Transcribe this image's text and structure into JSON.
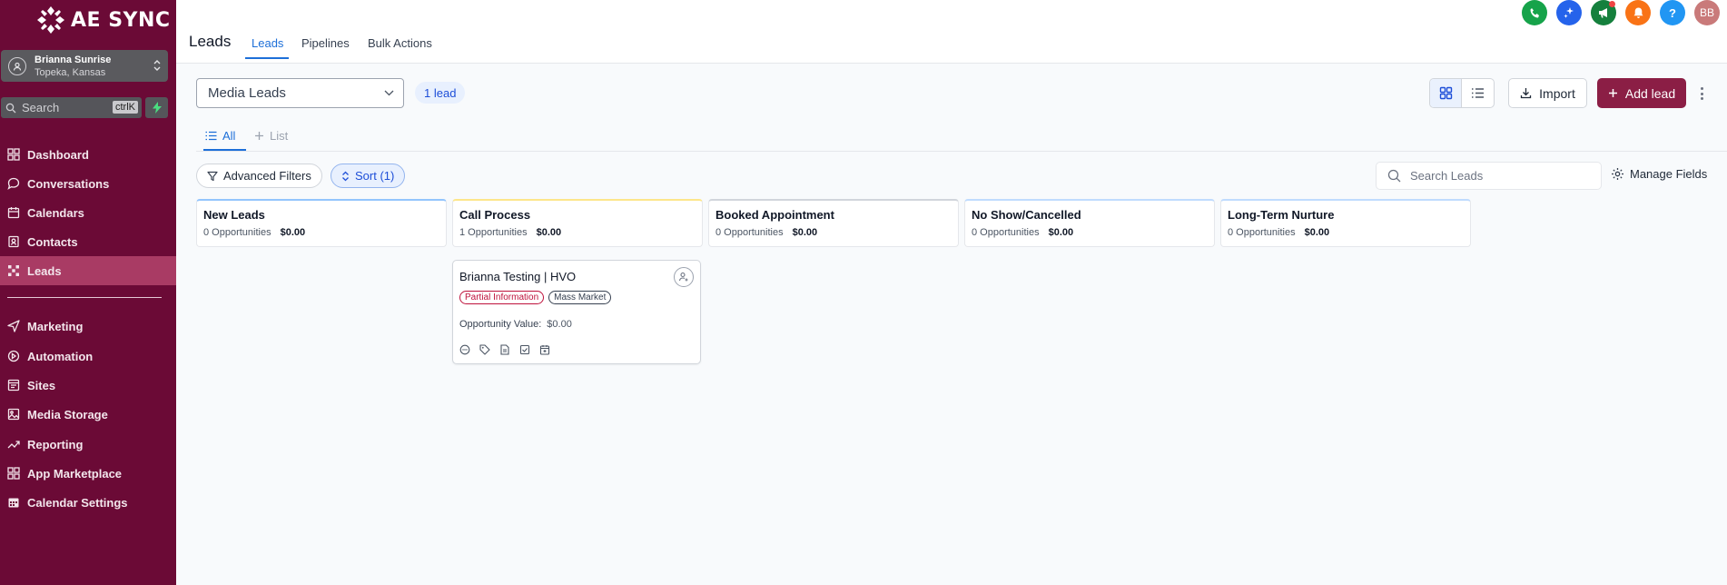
{
  "brand": {
    "name": "AE SYNC"
  },
  "account": {
    "name": "Brianna Sunrise",
    "location": "Topeka, Kansas"
  },
  "sidebar_search": {
    "placeholder": "Search",
    "shortcut": "ctrlK"
  },
  "nav": {
    "dashboard": "Dashboard",
    "conversations": "Conversations",
    "calendars": "Calendars",
    "contacts": "Contacts",
    "leads": "Leads",
    "marketing": "Marketing",
    "automation": "Automation",
    "sites": "Sites",
    "media_storage": "Media Storage",
    "reporting": "Reporting",
    "app_marketplace": "App Marketplace",
    "calendar_settings": "Calendar Settings"
  },
  "header": {
    "title": "Leads",
    "tabs": {
      "leads": "Leads",
      "pipelines": "Pipelines",
      "bulk_actions": "Bulk Actions"
    },
    "avatar_initials": "BB",
    "help": "?"
  },
  "toolbar": {
    "pipeline": "Media Leads",
    "lead_count": "1 lead",
    "import_label": "Import",
    "add_label": "Add lead"
  },
  "subtabs": {
    "all": "All",
    "list": "List"
  },
  "filters": {
    "advanced": "Advanced Filters",
    "sort": "Sort (1)",
    "search_placeholder": "Search Leads",
    "manage_fields": "Manage Fields"
  },
  "stages": [
    {
      "name": "New Leads",
      "count": "0 Opportunities",
      "value": "$0.00",
      "color": "#93c5fd"
    },
    {
      "name": "Call Process",
      "count": "1 Opportunities",
      "value": "$0.00",
      "color": "#fde68a"
    },
    {
      "name": "Booked Appointment",
      "count": "0 Opportunities",
      "value": "$0.00",
      "color": "#d1d5db"
    },
    {
      "name": "No Show/Cancelled",
      "count": "0 Opportunities",
      "value": "$0.00",
      "color": "#bfdbfe"
    },
    {
      "name": "Long-Term Nurture",
      "count": "0 Opportunities",
      "value": "$0.00",
      "color": "#bfdbfe"
    }
  ],
  "card": {
    "title": "Brianna Testing | HVO",
    "tags": [
      "Partial Information",
      "Mass Market"
    ],
    "opportunity_label": "Opportunity Value:",
    "opportunity_value": "$0.00"
  },
  "colors": {
    "sidebar": "#6b0a36",
    "active_nav": "#a93b64",
    "accent": "#1d6fd8",
    "primary_button": "#8b1e45"
  }
}
